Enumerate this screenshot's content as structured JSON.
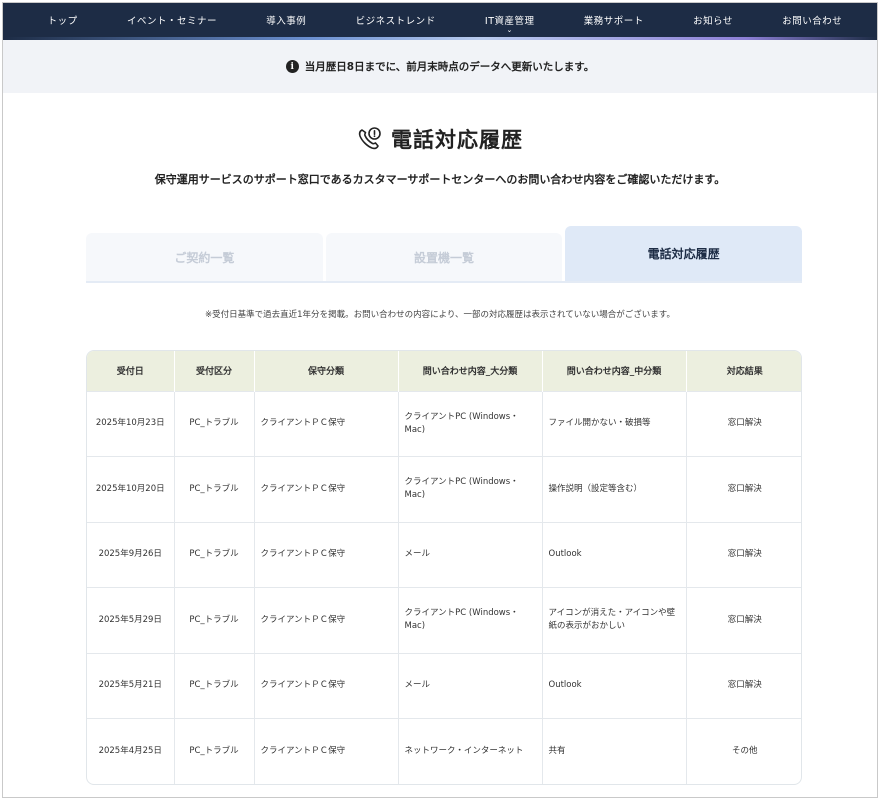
{
  "nav": {
    "items": [
      "トップ",
      "イベント・セミナー",
      "導入事例",
      "ビジネストレンド",
      "IT資産管理",
      "業務サポート",
      "お知らせ",
      "お問い合わせ"
    ],
    "caret": "⌄"
  },
  "notice": {
    "icon": "info-icon",
    "text": "当月歴日8日までに、前月末時点のデータへ更新いたします。"
  },
  "page": {
    "title": "電話対応履歴",
    "title_icon": "phone-alert-icon",
    "subtitle": "保守運用サービスのサポート窓口であるカスタマーサポートセンターへのお問い合わせ内容をご確認いただけます。"
  },
  "tabs": [
    {
      "label": "ご契約一覧",
      "active": false
    },
    {
      "label": "設置機一覧",
      "active": false
    },
    {
      "label": "電話対応履歴",
      "active": true
    }
  ],
  "note": "※受付日基準で過去直近1年分を掲載。お問い合わせの内容により、一部の対応履歴は表示されていない場合がございます。",
  "table": {
    "headers": [
      "受付日",
      "受付区分",
      "保守分類",
      "問い合わせ内容_大分類",
      "問い合わせ内容_中分類",
      "対応結果"
    ],
    "rows": [
      [
        "2025年10月23日",
        "PC_トラブル",
        "クライアントＰＣ保守",
        "クライアントPC (Windows・Mac)",
        "ファイル開かない・破損等",
        "窓口解決"
      ],
      [
        "2025年10月20日",
        "PC_トラブル",
        "クライアントＰＣ保守",
        "クライアントPC (Windows・Mac)",
        "操作説明（設定等含む）",
        "窓口解決"
      ],
      [
        "2025年9月26日",
        "PC_トラブル",
        "クライアントＰＣ保守",
        "メール",
        "Outlook",
        "窓口解決"
      ],
      [
        "2025年5月29日",
        "PC_トラブル",
        "クライアントＰＣ保守",
        "クライアントPC (Windows・Mac)",
        "アイコンが消えた・アイコンや壁紙の表示がおかしい",
        "窓口解決"
      ],
      [
        "2025年5月21日",
        "PC_トラブル",
        "クライアントＰＣ保守",
        "メール",
        "Outlook",
        "窓口解決"
      ],
      [
        "2025年4月25日",
        "PC_トラブル",
        "クライアントＰＣ保守",
        "ネットワーク・インターネット",
        "共有",
        "その他"
      ]
    ]
  },
  "colors": {
    "nav_bg": "#1d2c45",
    "notice_bg": "#f1f3f7",
    "active_tab_bg": "#dfe9f7",
    "table_header_bg": "#ecefdf"
  }
}
